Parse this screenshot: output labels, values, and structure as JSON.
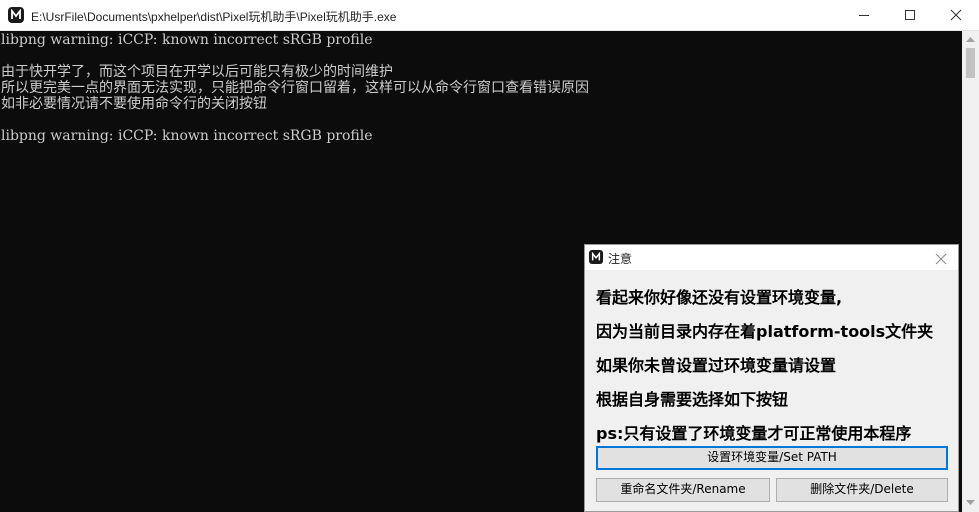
{
  "window": {
    "title": "E:\\UsrFile\\Documents\\pxhelper\\dist\\Pixel玩机助手\\Pixel玩机助手.exe"
  },
  "console": {
    "lines": [
      "libpng warning: iCCP: known incorrect sRGB profile",
      "",
      "由于快开学了，而这个项目在开学以后可能只有极少的时间维护",
      "所以更完美一点的界面无法实现，只能把命令行窗口留着，这样可以从命令行窗口查看错误原因",
      "如非必要情况请不要使用命令行的关闭按钮",
      "",
      "libpng warning: iCCP: known incorrect sRGB profile"
    ]
  },
  "dialog": {
    "title": "注意",
    "messages": [
      "看起来你好像还没有设置环境变量,",
      "因为当前目录内存在着platform-tools文件夹",
      "如果你未曾设置过环境变量请设置",
      "根据自身需要选择如下按钮",
      "ps:只有设置了环境变量才可正常使用本程序"
    ],
    "buttons": {
      "set_path": "设置环境变量/Set PATH",
      "rename": "重命名文件夹/Rename",
      "delete": "删除文件夹/Delete"
    }
  },
  "icons": {
    "app": "app-logo-icon",
    "minimize": "minimize-icon",
    "maximize": "maximize-icon",
    "close": "close-icon"
  }
}
